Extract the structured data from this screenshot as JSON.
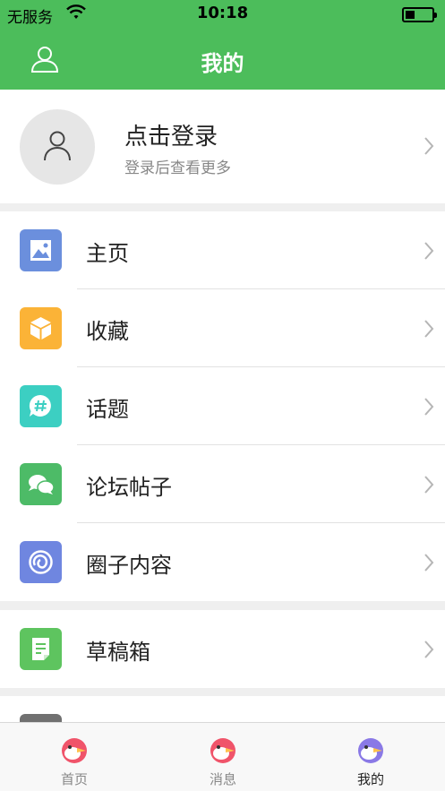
{
  "status_bar": {
    "carrier": "无服务",
    "time": "10:18",
    "battery_level": 0.35
  },
  "navbar": {
    "title": "我的",
    "left_icon": "user-icon"
  },
  "profile": {
    "title": "点击登录",
    "subtitle": "登录后查看更多",
    "avatar_icon": "user-icon"
  },
  "menu": [
    {
      "label": "主页",
      "icon": "image-icon",
      "color": "#6b8fdd"
    },
    {
      "label": "收藏",
      "icon": "box-icon",
      "color": "#fbb337"
    },
    {
      "label": "话题",
      "icon": "hashtag-bubble-icon",
      "color": "#3ccfc2"
    },
    {
      "label": "论坛帖子",
      "icon": "chat-bubbles-icon",
      "color": "#4dbb67"
    },
    {
      "label": "圈子内容",
      "icon": "spiral-icon",
      "color": "#6f86e0"
    }
  ],
  "menu2": [
    {
      "label": "草稿箱",
      "icon": "note-icon",
      "color": "#5ec45f"
    }
  ],
  "tabbar": {
    "tabs": [
      {
        "label": "首页",
        "icon": "bird-icon",
        "color": "#f0546a"
      },
      {
        "label": "消息",
        "icon": "bird-icon",
        "color": "#f0546a"
      },
      {
        "label": "我的",
        "icon": "bird-icon",
        "color": "#8a79e6",
        "active": true
      }
    ]
  },
  "colors": {
    "header_green": "#4cbd5b",
    "background": "#efefef"
  }
}
